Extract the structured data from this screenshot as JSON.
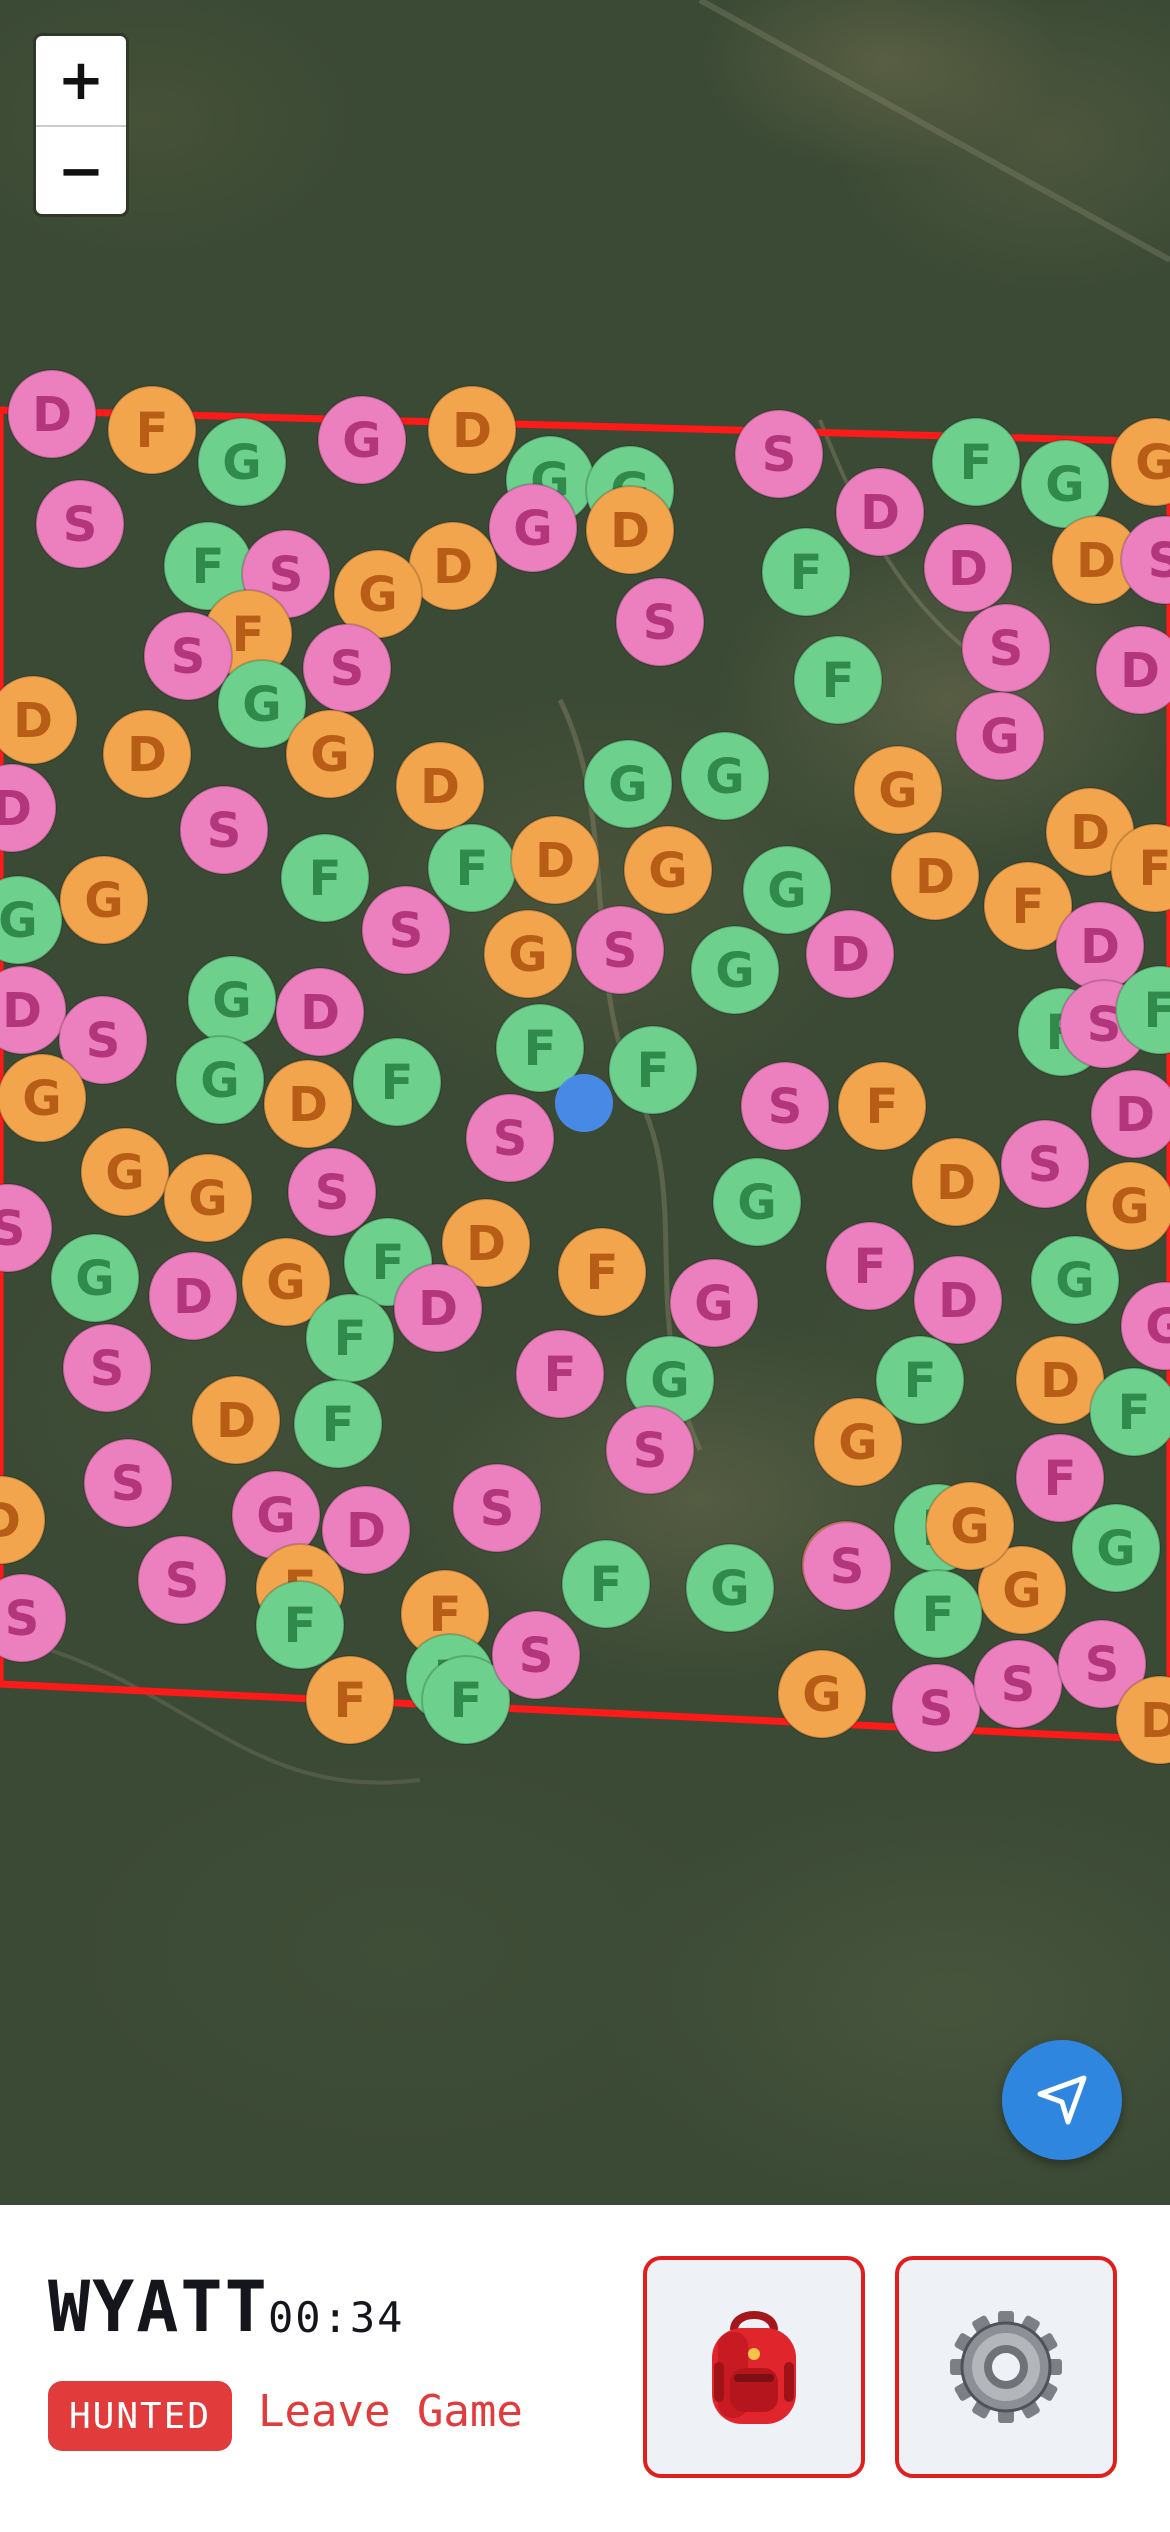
{
  "map": {
    "zoom_in_label": "+",
    "zoom_out_label": "−",
    "boundary_color": "#ff1a1a",
    "marker_colors": {
      "D": "#ec7fbe",
      "F": "#f3a54e",
      "G": "#6dd08c",
      "S": "#ec7fbe"
    },
    "markers": [
      {
        "l": "D",
        "c": "p"
      },
      {
        "l": "F",
        "c": "o"
      },
      {
        "l": "G",
        "c": "g"
      },
      {
        "l": "G",
        "c": "p"
      },
      {
        "l": "D",
        "c": "o"
      },
      {
        "l": "G",
        "c": "g"
      },
      {
        "l": "G",
        "c": "g"
      },
      {
        "l": "S",
        "c": "p"
      },
      {
        "l": "D",
        "c": "p"
      },
      {
        "l": "F",
        "c": "g"
      },
      {
        "l": "G",
        "c": "g"
      },
      {
        "l": "G",
        "c": "o"
      },
      {
        "l": "S",
        "c": "p"
      },
      {
        "l": "F",
        "c": "g"
      },
      {
        "l": "G",
        "c": "p"
      },
      {
        "l": "D",
        "c": "o"
      },
      {
        "l": "D",
        "c": "o"
      },
      {
        "l": "S",
        "c": "p"
      },
      {
        "l": "F",
        "c": "o"
      },
      {
        "l": "S",
        "c": "p"
      },
      {
        "l": "G",
        "c": "o"
      },
      {
        "l": "F",
        "c": "g"
      },
      {
        "l": "D",
        "c": "p"
      },
      {
        "l": "D",
        "c": "o"
      },
      {
        "l": "S",
        "c": "p"
      },
      {
        "l": "S",
        "c": "p"
      },
      {
        "l": "S",
        "c": "p"
      },
      {
        "l": "G",
        "c": "g"
      },
      {
        "l": "S",
        "c": "p"
      },
      {
        "l": "D",
        "c": "o"
      },
      {
        "l": "D",
        "c": "p"
      },
      {
        "l": "D",
        "c": "o"
      },
      {
        "l": "G",
        "c": "o"
      },
      {
        "l": "D",
        "c": "o"
      },
      {
        "l": "F",
        "c": "g"
      },
      {
        "l": "G",
        "c": "g"
      },
      {
        "l": "G",
        "c": "g"
      },
      {
        "l": "G",
        "c": "p"
      },
      {
        "l": "G",
        "c": "o"
      },
      {
        "l": "D",
        "c": "p"
      },
      {
        "l": "S",
        "c": "p"
      },
      {
        "l": "F",
        "c": "g"
      },
      {
        "l": "F",
        "c": "g"
      },
      {
        "l": "D",
        "c": "o"
      },
      {
        "l": "G",
        "c": "o"
      },
      {
        "l": "D",
        "c": "o"
      },
      {
        "l": "D",
        "c": "o"
      },
      {
        "l": "F",
        "c": "o"
      },
      {
        "l": "G",
        "c": "g"
      },
      {
        "l": "G",
        "c": "o"
      },
      {
        "l": "S",
        "c": "p"
      },
      {
        "l": "G",
        "c": "o"
      },
      {
        "l": "S",
        "c": "p"
      },
      {
        "l": "G",
        "c": "g"
      },
      {
        "l": "G",
        "c": "g"
      },
      {
        "l": "D",
        "c": "p"
      },
      {
        "l": "F",
        "c": "o"
      },
      {
        "l": "D",
        "c": "p"
      },
      {
        "l": "G",
        "c": "g"
      },
      {
        "l": "D",
        "c": "p"
      },
      {
        "l": "S",
        "c": "p"
      },
      {
        "l": "D",
        "c": "p"
      },
      {
        "l": "F",
        "c": "g"
      },
      {
        "l": "F",
        "c": "g"
      },
      {
        "l": "S",
        "c": "p"
      },
      {
        "l": "F",
        "c": "g"
      },
      {
        "l": "G",
        "c": "o"
      },
      {
        "l": "G",
        "c": "g"
      },
      {
        "l": "D",
        "c": "o"
      },
      {
        "l": "F",
        "c": "g"
      },
      {
        "l": "F",
        "c": "g"
      },
      {
        "l": "S",
        "c": "p"
      },
      {
        "l": "S",
        "c": "p"
      },
      {
        "l": "F",
        "c": "o"
      },
      {
        "l": "D",
        "c": "p"
      },
      {
        "l": "G",
        "c": "o"
      },
      {
        "l": "G",
        "c": "o"
      },
      {
        "l": "S",
        "c": "p"
      },
      {
        "l": "G",
        "c": "g"
      },
      {
        "l": "D",
        "c": "o"
      },
      {
        "l": "S",
        "c": "p"
      },
      {
        "l": "G",
        "c": "o"
      },
      {
        "l": "S",
        "c": "p"
      },
      {
        "l": "G",
        "c": "g"
      },
      {
        "l": "D",
        "c": "p"
      },
      {
        "l": "G",
        "c": "o"
      },
      {
        "l": "F",
        "c": "g"
      },
      {
        "l": "D",
        "c": "o"
      },
      {
        "l": "F",
        "c": "o"
      },
      {
        "l": "G",
        "c": "p"
      },
      {
        "l": "F",
        "c": "p"
      },
      {
        "l": "D",
        "c": "p"
      },
      {
        "l": "G",
        "c": "g"
      },
      {
        "l": "G",
        "c": "p"
      },
      {
        "l": "F",
        "c": "g"
      },
      {
        "l": "S",
        "c": "p"
      },
      {
        "l": "D",
        "c": "o"
      },
      {
        "l": "F",
        "c": "g"
      },
      {
        "l": "D",
        "c": "p"
      },
      {
        "l": "F",
        "c": "p"
      },
      {
        "l": "G",
        "c": "g"
      },
      {
        "l": "S",
        "c": "p"
      },
      {
        "l": "F",
        "c": "g"
      },
      {
        "l": "D",
        "c": "o"
      },
      {
        "l": "F",
        "c": "g"
      },
      {
        "l": "S",
        "c": "p"
      },
      {
        "l": "D",
        "c": "o"
      },
      {
        "l": "G",
        "c": "p"
      },
      {
        "l": "D",
        "c": "p"
      },
      {
        "l": "S",
        "c": "p"
      },
      {
        "l": "G",
        "c": "o"
      },
      {
        "l": "F",
        "c": "g"
      },
      {
        "l": "F",
        "c": "p"
      },
      {
        "l": "G",
        "c": "g"
      },
      {
        "l": "S",
        "c": "p"
      },
      {
        "l": "F",
        "c": "o"
      },
      {
        "l": "S",
        "c": "p"
      },
      {
        "l": "F",
        "c": "g"
      },
      {
        "l": "G",
        "c": "o"
      },
      {
        "l": "F",
        "c": "o"
      },
      {
        "l": "F",
        "c": "g"
      },
      {
        "l": "F",
        "c": "g"
      },
      {
        "l": "G",
        "c": "g"
      },
      {
        "l": "D",
        "c": "o"
      },
      {
        "l": "G",
        "c": "o"
      },
      {
        "l": "F",
        "c": "g"
      },
      {
        "l": "S",
        "c": "p"
      },
      {
        "l": "F",
        "c": "o"
      },
      {
        "l": "S",
        "c": "p"
      },
      {
        "l": "F",
        "c": "g"
      },
      {
        "l": "G",
        "c": "o"
      },
      {
        "l": "S",
        "c": "p"
      },
      {
        "l": "S",
        "c": "p"
      },
      {
        "l": "S",
        "c": "p"
      },
      {
        "l": "D",
        "c": "o"
      },
      {
        "l": "S",
        "c": "p"
      }
    ]
  },
  "player": {
    "name": "WYATT",
    "timer": "00:34",
    "status": "HUNTED",
    "leave_label": "Leave Game"
  },
  "actions": {
    "backpack_icon": "backpack-icon",
    "settings_icon": "gear-icon"
  }
}
